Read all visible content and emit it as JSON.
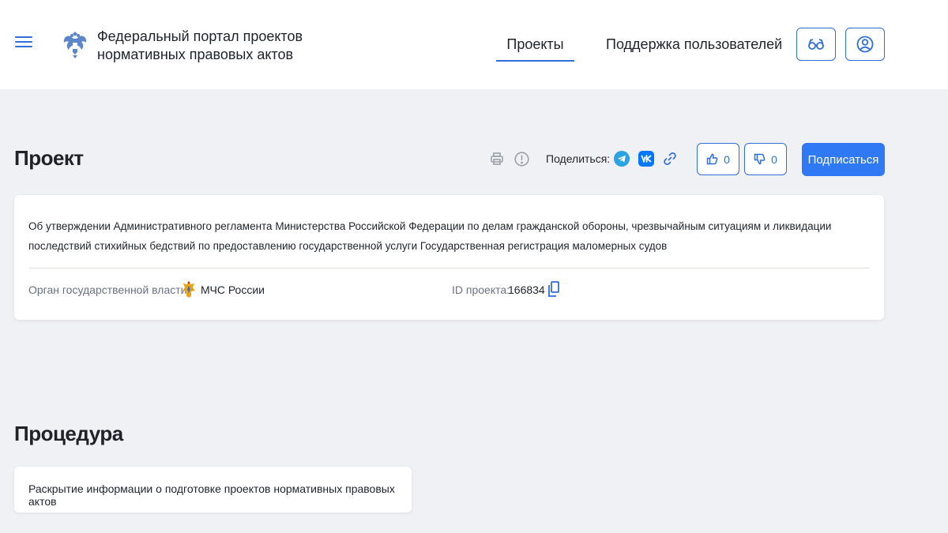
{
  "header": {
    "site_title_line1": "Федеральный портал проектов",
    "site_title_line2": "нормативных правовых актов",
    "nav": {
      "projects": "Проекты",
      "support": "Поддержка пользователей"
    },
    "icons": {
      "menu": "hamburger-icon",
      "logo": "coat-of-arms-icon",
      "accessibility": "glasses-icon",
      "account": "user-icon"
    }
  },
  "project": {
    "heading": "Проект",
    "share_label": "Поделиться:",
    "likes": "0",
    "dislikes": "0",
    "subscribe_label": "Подписаться",
    "description": "Об утверждении Административного регламента Министерства Российской Федерации по делам гражданской обороны, чрезвычайным ситуациям и ликвидации последствий стихийных бедствий по предоставлению государственной услуги Государственная регистрация маломерных судов",
    "authority_label": "Орган государственной власти:",
    "authority_value": "МЧС России",
    "id_label": "ID проекта:",
    "id_value": "166834",
    "icons": {
      "print": "printer-icon",
      "report": "exclamation-icon",
      "telegram": "telegram-icon",
      "vk": "vk-icon",
      "link": "link-icon",
      "like": "thumbs-up-icon",
      "dislike": "thumbs-down-icon",
      "copy": "copy-icon",
      "authority": "mchs-emblem-icon"
    }
  },
  "procedure": {
    "heading": "Процедура",
    "text": "Раскрытие информации о подготовке проектов нормативных правовых актов"
  },
  "colors": {
    "accent": "#2f6fd9",
    "primary_button": "#2f79f5",
    "telegram": "#2aa3e0",
    "vk": "#0077ff",
    "background": "#f0f1f4"
  }
}
